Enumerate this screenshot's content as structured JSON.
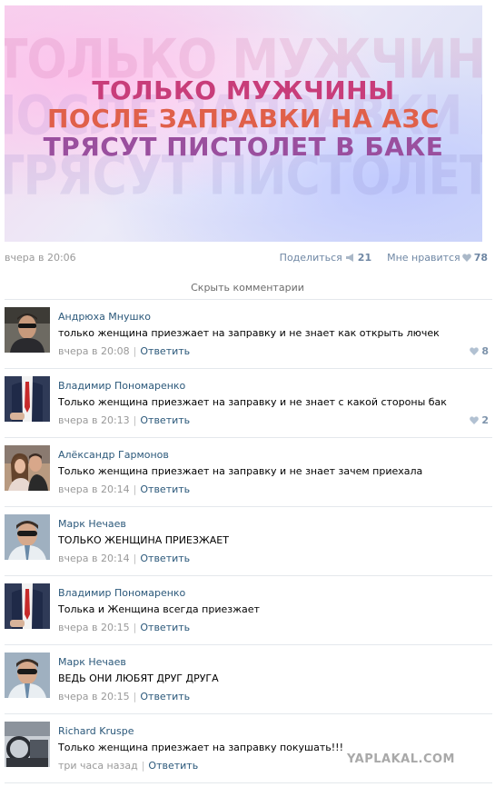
{
  "banner": {
    "lines": [
      "ТОЛЬКО МУЖЧИНЫ",
      "ПОСЛЕ ЗАПРАВКИ НА АЗС",
      "ТРЯСУТ ПИСТОЛЕТ В БАКЕ"
    ],
    "bg_lines": [
      "ТОЛЬКО МУЖЧИНЫ",
      "ПОСЛЕ ЗАПРАВКИ НА АЗС",
      "ТРЯСУТ ПИСТОЛЕТ В БАКЕ"
    ],
    "colors": {
      "line1": "#c83d7a",
      "line2": "#e0604a",
      "line3": "#9a4f9e"
    }
  },
  "post": {
    "date": "вчера в 20:06",
    "share_label": "Поделиться",
    "share_count": "21",
    "like_label": "Мне нравится",
    "like_count": "78"
  },
  "hide_comments": "Скрыть комментарии",
  "comments": [
    {
      "author": "Андрюха Мнушко",
      "text": "только женщина приезжает на заправку и не знает как открыть лючек",
      "time": "вчера в 20:08",
      "reply": "Ответить",
      "likes": "8",
      "avatar": "man-sunglasses-avatar"
    },
    {
      "author": "Владимир Пономаренко",
      "text": "Только женщина приезжает на заправку и не знает с какой стороны бак",
      "time": "вчера в 20:13",
      "reply": "Ответить",
      "likes": "2",
      "avatar": "suit-red-tie-avatar"
    },
    {
      "author": "Алёксандр Гармонов",
      "text": "Только женщина приезжает на заправку и не знает зачем приехала",
      "time": "вчера в 20:14",
      "reply": "Ответить",
      "likes": "",
      "avatar": "couple-photo-avatar"
    },
    {
      "author": "Марк Нечаев",
      "text": "ТОЛЬКО ЖЕНЩИНА ПРИЕЗЖАЕТ",
      "time": "вчера в 20:14",
      "reply": "Ответить",
      "likes": "",
      "avatar": "man-sunglasses-avatar"
    },
    {
      "author": "Владимир Пономаренко",
      "text": "Толька и Женщина всегда приезжает",
      "time": "вчера в 20:15",
      "reply": "Ответить",
      "likes": "",
      "avatar": "suit-red-tie-avatar"
    },
    {
      "author": "Марк Нечаев",
      "text": "ВЕДЬ ОНИ ЛЮБЯТ ДРУГ ДРУГА",
      "time": "вчера в 20:15",
      "reply": "Ответить",
      "likes": "",
      "avatar": "man-sunglasses-avatar"
    },
    {
      "author": "Richard Kruspe",
      "text": "Только женщина приезжает на заправку покушать!!!",
      "time": "три часа назад",
      "reply": "Ответить",
      "likes": "",
      "avatar": "car-interior-avatar"
    }
  ],
  "watermark": "YAPLAKAL.COM",
  "colors": {
    "link": "#2b587a",
    "muted": "#999999",
    "action": "#6f87a4"
  }
}
